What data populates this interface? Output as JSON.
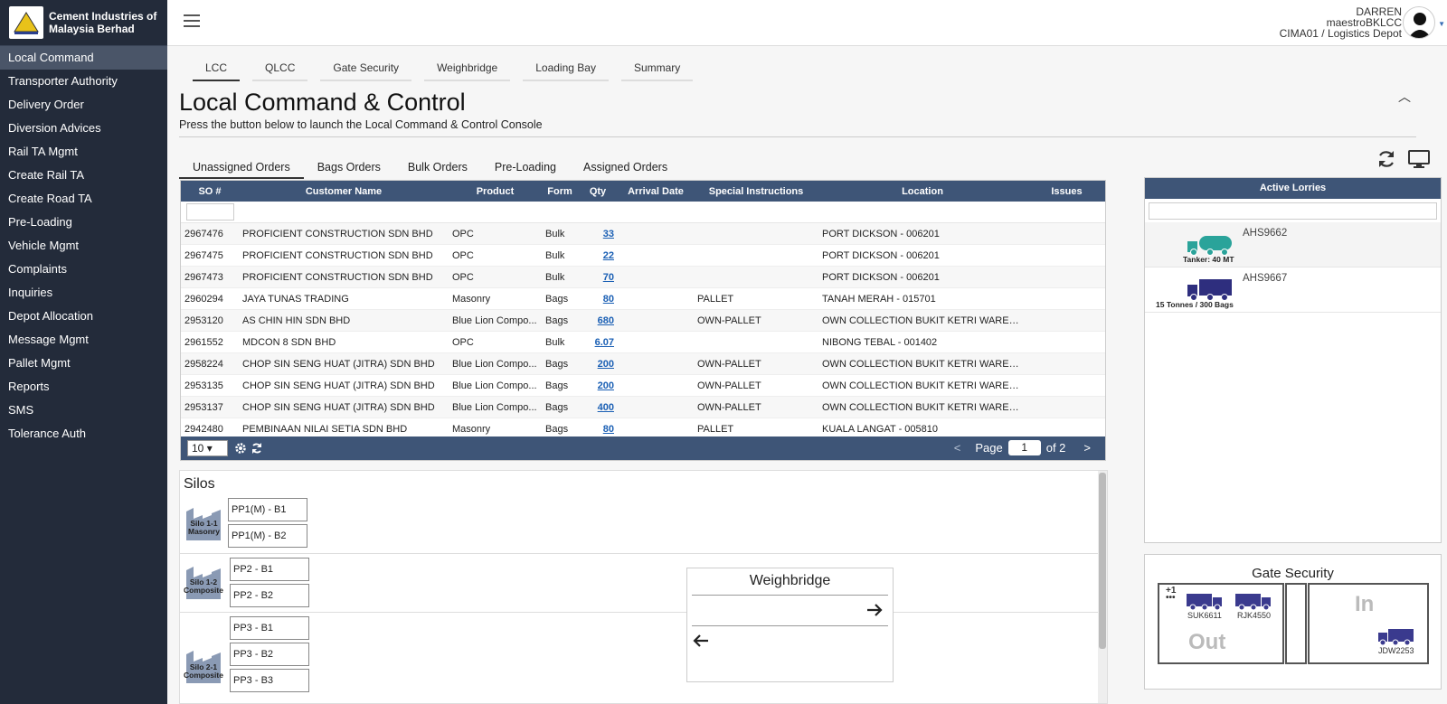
{
  "brand": {
    "line1": "Cement Industries of",
    "line2": "Malaysia Berhad"
  },
  "sidebar": {
    "items": [
      {
        "label": "Local Command"
      },
      {
        "label": "Transporter Authority"
      },
      {
        "label": "Delivery Order"
      },
      {
        "label": "Diversion Advices"
      },
      {
        "label": "Rail TA Mgmt"
      },
      {
        "label": "Create Rail TA"
      },
      {
        "label": "Create Road TA"
      },
      {
        "label": "Pre-Loading"
      },
      {
        "label": "Vehicle Mgmt"
      },
      {
        "label": "Complaints"
      },
      {
        "label": "Inquiries"
      },
      {
        "label": "Depot Allocation"
      },
      {
        "label": "Message Mgmt"
      },
      {
        "label": "Pallet Mgmt"
      },
      {
        "label": "Reports"
      },
      {
        "label": "SMS"
      },
      {
        "label": "Tolerance Auth"
      }
    ]
  },
  "user": {
    "name": "DARREN",
    "account": "maestroBKLCC",
    "location": "CIMA01 / Logistics Depot"
  },
  "top_tabs": [
    "LCC",
    "QLCC",
    "Gate Security",
    "Weighbridge",
    "Loading Bay",
    "Summary"
  ],
  "page": {
    "title": "Local Command & Control",
    "subtitle": "Press the button below to launch the Local Command & Control Console"
  },
  "order_tabs": [
    "Unassigned Orders",
    "Bags Orders",
    "Bulk Orders",
    "Pre-Loading",
    "Assigned Orders"
  ],
  "grid": {
    "headers": [
      "SO #",
      "Customer Name",
      "Product",
      "Form",
      "Qty",
      "Arrival Date",
      "Special Instructions",
      "Location",
      "Issues"
    ],
    "rows": [
      [
        "2967476",
        "PROFICIENT CONSTRUCTION SDN BHD",
        "OPC",
        "Bulk",
        "33",
        "",
        "",
        "PORT DICKSON - 006201",
        ""
      ],
      [
        "2967475",
        "PROFICIENT CONSTRUCTION SDN BHD",
        "OPC",
        "Bulk",
        "22",
        "",
        "",
        "PORT DICKSON - 006201",
        ""
      ],
      [
        "2967473",
        "PROFICIENT CONSTRUCTION SDN BHD",
        "OPC",
        "Bulk",
        "70",
        "",
        "",
        "PORT DICKSON - 006201",
        ""
      ],
      [
        "2960294",
        "JAYA TUNAS TRADING",
        "Masonry",
        "Bags",
        "80",
        "",
        "PALLET",
        "TANAH MERAH - 015701",
        ""
      ],
      [
        "2953120",
        "AS CHIN HIN SDN BHD",
        "Blue Lion Compo...",
        "Bags",
        "680",
        "",
        "OWN-PALLET",
        "OWN COLLECTION BUKIT KETRI WAREHOU...",
        ""
      ],
      [
        "2961552",
        "MDCON 8 SDN BHD",
        "OPC",
        "Bulk",
        "6.07",
        "",
        "",
        "NIBONG TEBAL - 001402",
        ""
      ],
      [
        "2958224",
        "CHOP SIN SENG HUAT (JITRA) SDN BHD",
        "Blue Lion Compo...",
        "Bags",
        "200",
        "",
        "OWN-PALLET",
        "OWN COLLECTION BUKIT KETRI WAREHOU...",
        ""
      ],
      [
        "2953135",
        "CHOP SIN SENG HUAT (JITRA) SDN BHD",
        "Blue Lion Compo...",
        "Bags",
        "200",
        "",
        "OWN-PALLET",
        "OWN COLLECTION BUKIT KETRI WAREHOU...",
        ""
      ],
      [
        "2953137",
        "CHOP SIN SENG HUAT (JITRA) SDN BHD",
        "Blue Lion Compo...",
        "Bags",
        "400",
        "",
        "OWN-PALLET",
        "OWN COLLECTION BUKIT KETRI WAREHOU...",
        ""
      ],
      [
        "2942480",
        "PEMBINAAN NILAI SETIA SDN BHD",
        "Masonry",
        "Bags",
        "80",
        "",
        "PALLET",
        "KUALA LANGAT - 005810",
        ""
      ]
    ],
    "page_size": "10",
    "page_label": "Page",
    "page_number": "1",
    "page_of": "of 2",
    "prev": "<",
    "next": ">"
  },
  "silos": {
    "title": "Silos",
    "groups": [
      {
        "label1": "Silo 1-1",
        "label2": "Masonry",
        "bays": [
          "PP1(M) - B1",
          "PP1(M) - B2"
        ]
      },
      {
        "label1": "Silo 1-2",
        "label2": "Composite",
        "bays": [
          "PP2 - B1",
          "PP2 - B2"
        ]
      },
      {
        "label1": "Silo 2-1",
        "label2": "Composite",
        "bays": [
          "PP3 - B1",
          "PP3 - B2",
          "PP3 - B3"
        ]
      }
    ]
  },
  "weighbridge": {
    "title": "Weighbridge"
  },
  "lorries": {
    "title": "Active Lorries",
    "items": [
      {
        "plate": "AHS9662",
        "label": "Tanker: 40 MT",
        "color": "#2aa39a"
      },
      {
        "plate": "AHS9667",
        "label": "15 Tonnes / 300 Bags",
        "color": "#2e2e7e"
      }
    ]
  },
  "gate": {
    "title": "Gate Security",
    "overflow": "+1",
    "out_label": "Out",
    "in_label": "In",
    "out_trucks": [
      "SUK6611",
      "RJK4550"
    ],
    "in_trucks": [
      "JDW2253"
    ],
    "truck_color": "#3a3a8e"
  },
  "colors": {
    "sidebar_bg": "#232b3a",
    "header_bg": "#3e5577",
    "link": "#1a5fb4"
  }
}
